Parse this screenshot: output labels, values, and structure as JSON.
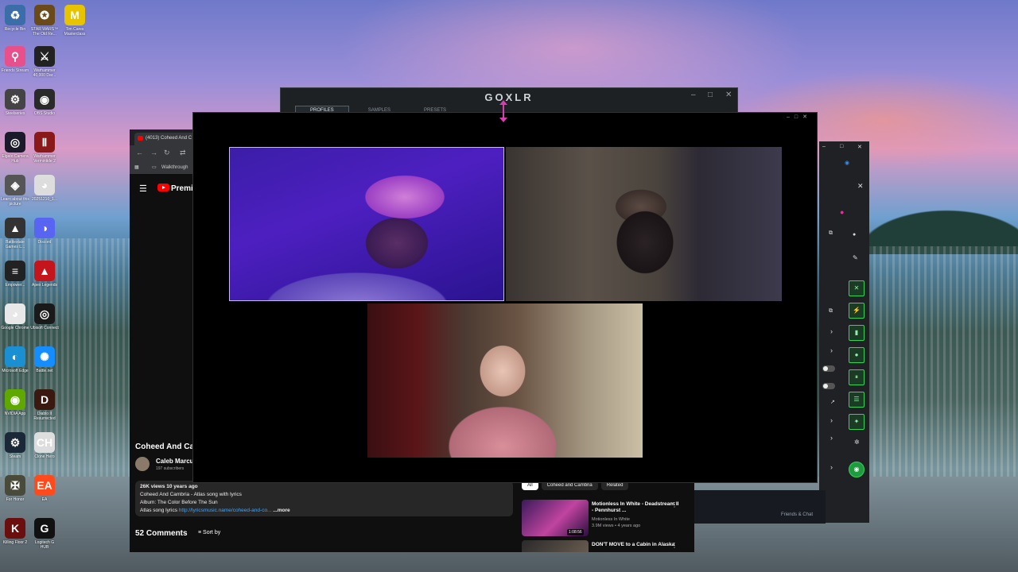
{
  "desktop": {
    "icons": [
      {
        "label": "Recycle Bin",
        "icon": "recycle-bin-icon",
        "color": "#3b6ea8"
      },
      {
        "label": "STAR WARS™ The Old Re...",
        "icon": "star-wars-icon",
        "color": "#6b4a1a"
      },
      {
        "label": "Tim Cares Masterclass",
        "icon": "masterclass-icon",
        "color": "#e8c400"
      },
      {
        "label": "Friends Stream",
        "icon": "map-pin-icon",
        "color": "#e8508c"
      },
      {
        "label": "Warhammer 40,000 Dar...",
        "icon": "warhammer-icon",
        "color": "#222222"
      },
      {
        "label": "Steelseries",
        "icon": "steelseries-icon",
        "color": "#444444"
      },
      {
        "label": "OBS Studio",
        "icon": "obs-icon",
        "color": "#2a2a2a"
      },
      {
        "label": "Elgato Camera Hub",
        "icon": "camera-hub-icon",
        "color": "#1a1a2a"
      },
      {
        "label": "Warhammer Vermintide 2",
        "icon": "vermintide-icon",
        "color": "#8a1a1a"
      },
      {
        "label": "Learn about this picture",
        "icon": "camera-icon",
        "color": "#555555"
      },
      {
        "label": "20251210_1...",
        "icon": "chrome-icon",
        "color": "#dddddd"
      },
      {
        "label": "Battlestate Games L...",
        "icon": "battlestate-icon",
        "color": "#333333"
      },
      {
        "label": "Discord",
        "icon": "discord-icon",
        "color": "#5865f2"
      },
      {
        "label": "Empower...",
        "icon": "empower-icon",
        "color": "#222222"
      },
      {
        "label": "Apex Legends",
        "icon": "apex-icon",
        "color": "#c4141c"
      },
      {
        "label": "Google Chrome",
        "icon": "chrome-icon",
        "color": "#e8e8e8"
      },
      {
        "label": "Ubisoft Connect",
        "icon": "ubisoft-icon",
        "color": "#1a1a1a"
      },
      {
        "label": "Microsoft Edge",
        "icon": "edge-icon",
        "color": "#1a8fd1"
      },
      {
        "label": "Battle.net",
        "icon": "battlenet-icon",
        "color": "#148eff"
      },
      {
        "label": "NVIDIA App",
        "icon": "nvidia-icon",
        "color": "#5fa800"
      },
      {
        "label": "Diablo II Resurrected",
        "icon": "diablo-icon",
        "color": "#3a1a10"
      },
      {
        "label": "Steam",
        "icon": "steam-icon",
        "color": "#1b2838"
      },
      {
        "label": "Clone Hero",
        "icon": "clone-hero-icon",
        "color": "#dddddd"
      },
      {
        "label": "For Honor",
        "icon": "for-honor-icon",
        "color": "#4a4a3a"
      },
      {
        "label": "EA",
        "icon": "ea-icon",
        "color": "#ff4a1c"
      },
      {
        "label": "Killing Floor 2",
        "icon": "killing-floor-icon",
        "color": "#6a0e0e"
      },
      {
        "label": "Logitech G HUB",
        "icon": "logitech-icon",
        "color": "#111111"
      }
    ]
  },
  "goxlr": {
    "title": "GOXLR",
    "tabs": [
      "PROFILES",
      "SAMPLES",
      "PRESETS"
    ],
    "active_tab": "PROFILES"
  },
  "youtube": {
    "tab_title": "(4013) Coheed And C",
    "bookmark": "Walkthrough",
    "logo_text": "Premiu",
    "video_title": "Coheed And Ca",
    "channel_name": "Caleb Marcu",
    "subscribers": "197 subscribers",
    "desc_line1": "26K views  10 years ago",
    "desc_line2": "Coheed And Cambria - Atlas song with lyrics",
    "desc_line3": "Album: The Color Before The Sun",
    "desc_line4_prefix": "Atlas song lyrics ",
    "desc_link": "http://lyricsmusic.name/coheed-and-co...",
    "desc_more": "...more",
    "comments_count": "52 Comments",
    "sort_label": "Sort by",
    "chips": [
      "All",
      "Coheed and Cambria",
      "Related"
    ],
    "recs": [
      {
        "title": "Motionless In White - Deadstream II - Pennhurst ...",
        "channel": "Motionless In White",
        "meta": "3.9M views • 4 years ago",
        "duration": "1:08:56"
      },
      {
        "title": "DON'T MOVE to a Cabin in Alaska",
        "channel": "",
        "meta": "",
        "duration": ""
      }
    ]
  },
  "steam": {
    "friends_label": "Friends & Chat"
  }
}
